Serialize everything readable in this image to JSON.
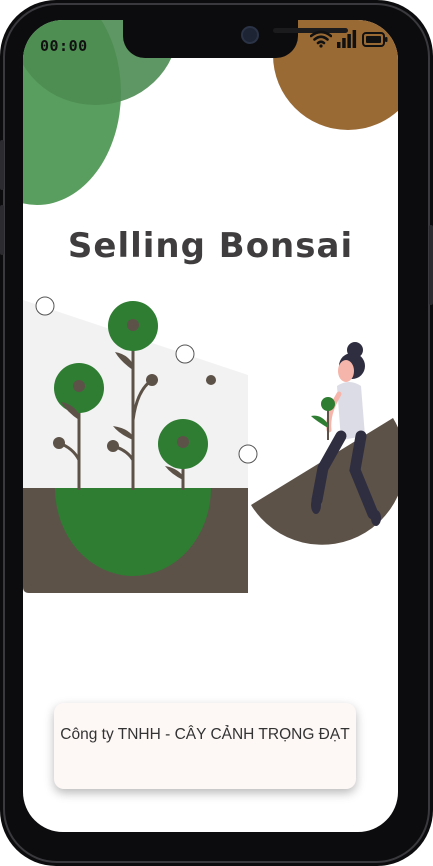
{
  "status_bar": {
    "time": "00:00"
  },
  "app": {
    "title": "Selling Bonsai",
    "company_name": "Công ty TNHH - CÂY CẢNH TRỌNG ĐẠT"
  },
  "colors": {
    "green_light": "#5a9e5f",
    "green_dark": "#2e7d32",
    "brown_accent": "#9a6a35",
    "soil": "#5d5248",
    "wall": "#f2f2f2",
    "title": "#3f3d3d"
  },
  "icons": [
    "wifi-icon",
    "signal-icon",
    "battery-icon"
  ]
}
